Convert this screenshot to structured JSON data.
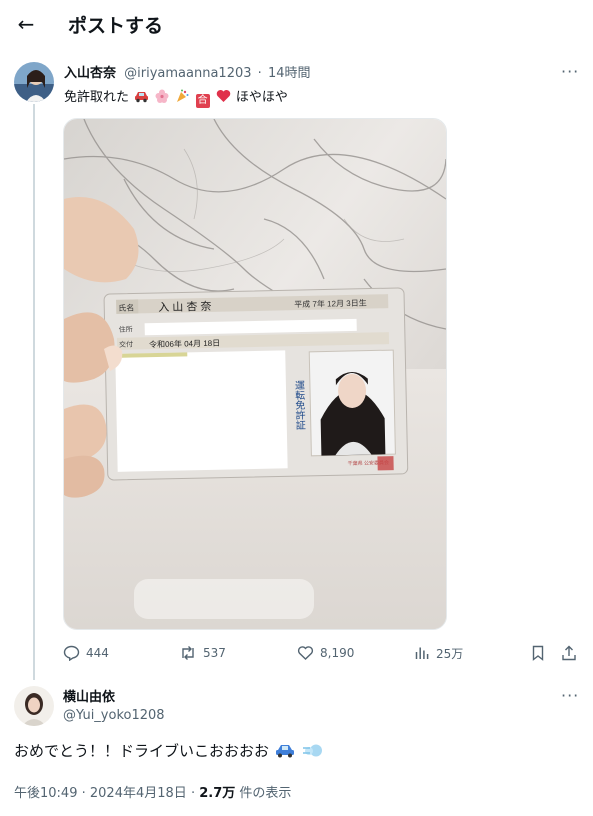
{
  "header": {
    "back_icon": "arrow-left-icon",
    "title": "ポストする"
  },
  "post": {
    "author_name": "入山杏奈",
    "author_handle": "@iriyamaanna1203",
    "separator": "·",
    "time_ago": "14時間",
    "text_prefix": "免許取れた",
    "text_emojis": [
      "car-icon",
      "sakura-icon",
      "party-icon",
      "pass-mark-icon",
      "heart-icon"
    ],
    "pass_char": "合",
    "text_suffix": "ほやほや",
    "image": {
      "license_name_label": "氏名",
      "license_name": "入 山 杏 奈",
      "license_birth": "平成 7年 12月 3日生",
      "address_label": "住所",
      "issue_label": "交付",
      "issue_date": "令和06年 04月 18日",
      "license_type_vertical": "運転免許証",
      "issuer": "千葉県 公安委員会"
    },
    "stats": {
      "replies": "444",
      "reposts": "537",
      "likes": "8,190",
      "views": "25万"
    }
  },
  "reply": {
    "author_name": "横山由依",
    "author_handle": "@Yui_yoko1208",
    "text": "おめでとう！！ドライブいこおおおお",
    "text_emojis": [
      "car-icon",
      "dash-icon"
    ],
    "time": "午後10:49",
    "separator": "·",
    "date": "2024年4月18日",
    "separator2": "·",
    "view_count": "2.7万",
    "view_suffix": "件の表示"
  },
  "colors": {
    "text": "#0f1419",
    "muted": "#536471",
    "thread_line": "#cfd9de",
    "card": "#e6e3df"
  }
}
